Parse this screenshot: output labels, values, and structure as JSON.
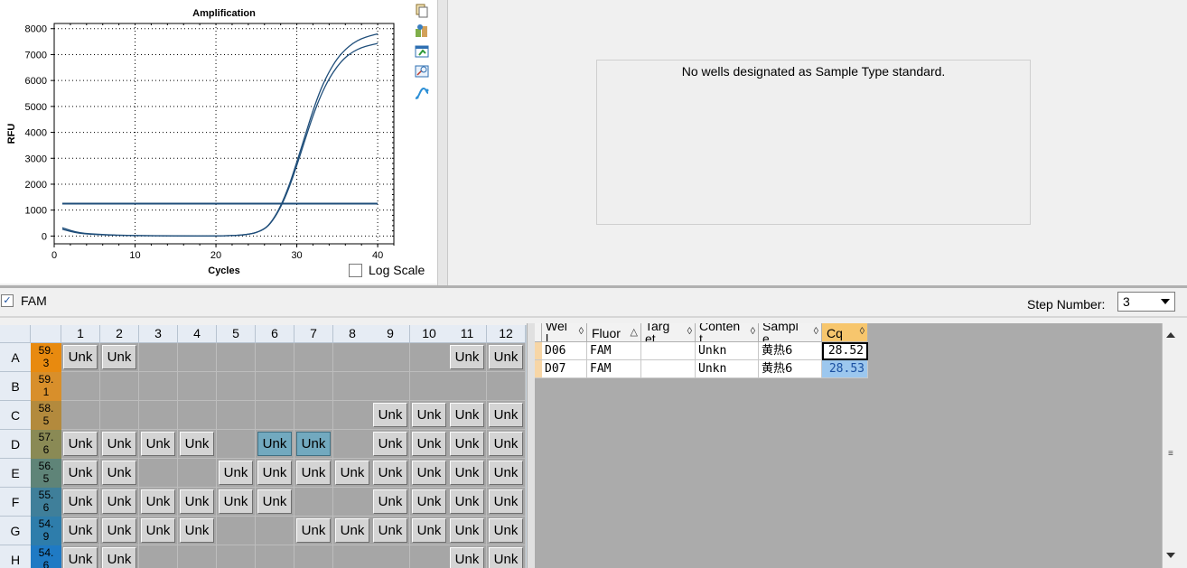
{
  "chart": {
    "title": "Amplification",
    "xlabel": "Cycles",
    "ylabel": "RFU",
    "xticks": [
      "0",
      "10",
      "20",
      "30",
      "40"
    ],
    "yticks": [
      "0",
      "1000",
      "2000",
      "3000",
      "4000",
      "5000",
      "6000",
      "7000",
      "8000"
    ],
    "log_scale_label": "Log Scale",
    "log_scale_checked": false
  },
  "chart_data": {
    "type": "line",
    "title": "Amplification",
    "xlabel": "Cycles",
    "ylabel": "RFU",
    "xlim": [
      0,
      42
    ],
    "ylim": [
      -300,
      8200
    ],
    "grid": true,
    "threshold": 1250,
    "series": [
      {
        "x": [
          1,
          3,
          6,
          10,
          15,
          20,
          24,
          26,
          27,
          28,
          29,
          30,
          31,
          32,
          33,
          34,
          35,
          36,
          37,
          38,
          39,
          40
        ],
        "values": [
          320,
          120,
          50,
          20,
          5,
          0,
          40,
          250,
          600,
          1150,
          1900,
          2850,
          3850,
          4850,
          5700,
          6350,
          6850,
          7200,
          7450,
          7620,
          7720,
          7800
        ]
      },
      {
        "x": [
          1,
          3,
          6,
          10,
          15,
          20,
          24,
          26,
          27,
          28,
          29,
          30,
          31,
          32,
          33,
          34,
          35,
          36,
          37,
          38,
          39,
          40
        ],
        "values": [
          260,
          100,
          40,
          15,
          3,
          0,
          40,
          240,
          580,
          1100,
          1820,
          2720,
          3700,
          4650,
          5450,
          6080,
          6550,
          6900,
          7120,
          7270,
          7360,
          7430
        ]
      }
    ]
  },
  "toolbar_icons": [
    "copy-icon",
    "export-icon",
    "save-chart-icon",
    "zoom-icon",
    "curve-settings-icon"
  ],
  "standard_message": "No wells designated as Sample Type standard.",
  "fluor_filter": {
    "label": "FAM",
    "checked": true
  },
  "step": {
    "label": "Step Number:",
    "value": "3"
  },
  "plate": {
    "columns": [
      "1",
      "2",
      "3",
      "4",
      "5",
      "6",
      "7",
      "8",
      "9",
      "10",
      "11",
      "12"
    ],
    "rows": [
      {
        "label": "A",
        "temp": "59.\n3",
        "color": "#e88a0f",
        "wells": [
          1,
          1,
          0,
          0,
          0,
          0,
          0,
          0,
          0,
          0,
          1,
          1
        ]
      },
      {
        "label": "B",
        "temp": "59.\n1",
        "color": "#d88f2b",
        "wells": [
          0,
          0,
          0,
          0,
          0,
          0,
          0,
          0,
          0,
          0,
          0,
          0
        ]
      },
      {
        "label": "C",
        "temp": "58.\n5",
        "color": "#b38a3d",
        "wells": [
          0,
          0,
          0,
          0,
          0,
          0,
          0,
          0,
          1,
          1,
          1,
          1
        ]
      },
      {
        "label": "D",
        "temp": "57.\n6",
        "color": "#8a8a55",
        "wells": [
          1,
          1,
          1,
          1,
          0,
          2,
          2,
          0,
          1,
          1,
          1,
          1
        ]
      },
      {
        "label": "E",
        "temp": "56.\n5",
        "color": "#5f8478",
        "wells": [
          1,
          1,
          0,
          0,
          1,
          1,
          1,
          1,
          1,
          1,
          1,
          1
        ]
      },
      {
        "label": "F",
        "temp": "55.\n6",
        "color": "#3f7f9a",
        "wells": [
          1,
          1,
          1,
          1,
          1,
          1,
          0,
          0,
          1,
          1,
          1,
          1
        ]
      },
      {
        "label": "G",
        "temp": "54.\n9",
        "color": "#2e7dab",
        "wells": [
          1,
          1,
          1,
          1,
          0,
          0,
          1,
          1,
          1,
          1,
          1,
          1
        ]
      },
      {
        "label": "H",
        "temp": "54.\n6",
        "color": "#1f7ac4",
        "wells": [
          1,
          1,
          0,
          0,
          0,
          0,
          0,
          0,
          0,
          0,
          1,
          1
        ]
      }
    ],
    "well_label": "Unk"
  },
  "table": {
    "headers": [
      {
        "label": "Wel\nl",
        "sort": "◊"
      },
      {
        "label": "Fluor",
        "sort": "△"
      },
      {
        "label": "Targ\net",
        "sort": "◊"
      },
      {
        "label": "Conten\nt",
        "sort": "◊"
      },
      {
        "label": "Sampl\ne",
        "sort": "◊"
      },
      {
        "label": "Cq",
        "sort": "◊"
      }
    ],
    "rows": [
      {
        "well": "D06",
        "fluor": "FAM",
        "target": "",
        "content": "Unkn",
        "sample": "黄热6",
        "cq": "28.52"
      },
      {
        "well": "D07",
        "fluor": "FAM",
        "target": "",
        "content": "Unkn",
        "sample": "黄热6",
        "cq": "28.53"
      }
    ]
  }
}
